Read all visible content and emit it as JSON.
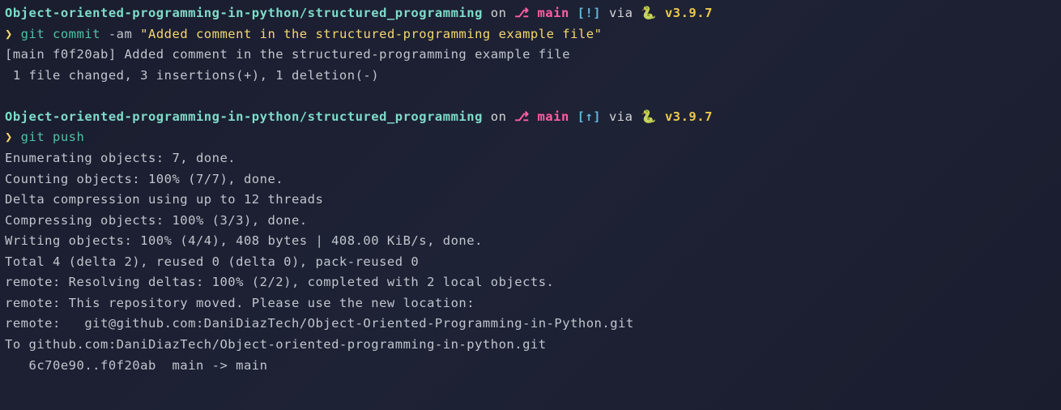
{
  "prompt1": {
    "path": "Object-oriented-programming-in-python/structured_programming",
    "on": " on ",
    "branch_icon": "⎇",
    "branch": " main ",
    "status": "[!]",
    "via": " via ",
    "snake": "🐍 ",
    "version": "v3.9.7"
  },
  "cmd1": {
    "prompt": "❯ ",
    "git": "git ",
    "subcmd": "commit ",
    "flag": "-am ",
    "string": "\"Added comment in the structured-programming example file\""
  },
  "out1": {
    "l1": "[main f0f20ab] Added comment in the structured-programming example file",
    "l2": " 1 file changed, 3 insertions(+), 1 deletion(-)"
  },
  "prompt2": {
    "path": "Object-oriented-programming-in-python/structured_programming",
    "on": " on ",
    "branch_icon": "⎇",
    "branch": " main ",
    "status": "[↑]",
    "via": " via ",
    "snake": "🐍 ",
    "version": "v3.9.7"
  },
  "cmd2": {
    "prompt": "❯ ",
    "git": "git ",
    "subcmd": "push"
  },
  "out2": {
    "l1": "Enumerating objects: 7, done.",
    "l2": "Counting objects: 100% (7/7), done.",
    "l3": "Delta compression using up to 12 threads",
    "l4": "Compressing objects: 100% (3/3), done.",
    "l5": "Writing objects: 100% (4/4), 408 bytes | 408.00 KiB/s, done.",
    "l6": "Total 4 (delta 2), reused 0 (delta 0), pack-reused 0",
    "l7": "remote: Resolving deltas: 100% (2/2), completed with 2 local objects.",
    "l8": "remote: This repository moved. Please use the new location:",
    "l9": "remote:   git@github.com:DaniDiazTech/Object-Oriented-Programming-in-Python.git",
    "l10": "To github.com:DaniDiazTech/Object-oriented-programming-in-python.git",
    "l11": "   6c70e90..f0f20ab  main -> main"
  }
}
